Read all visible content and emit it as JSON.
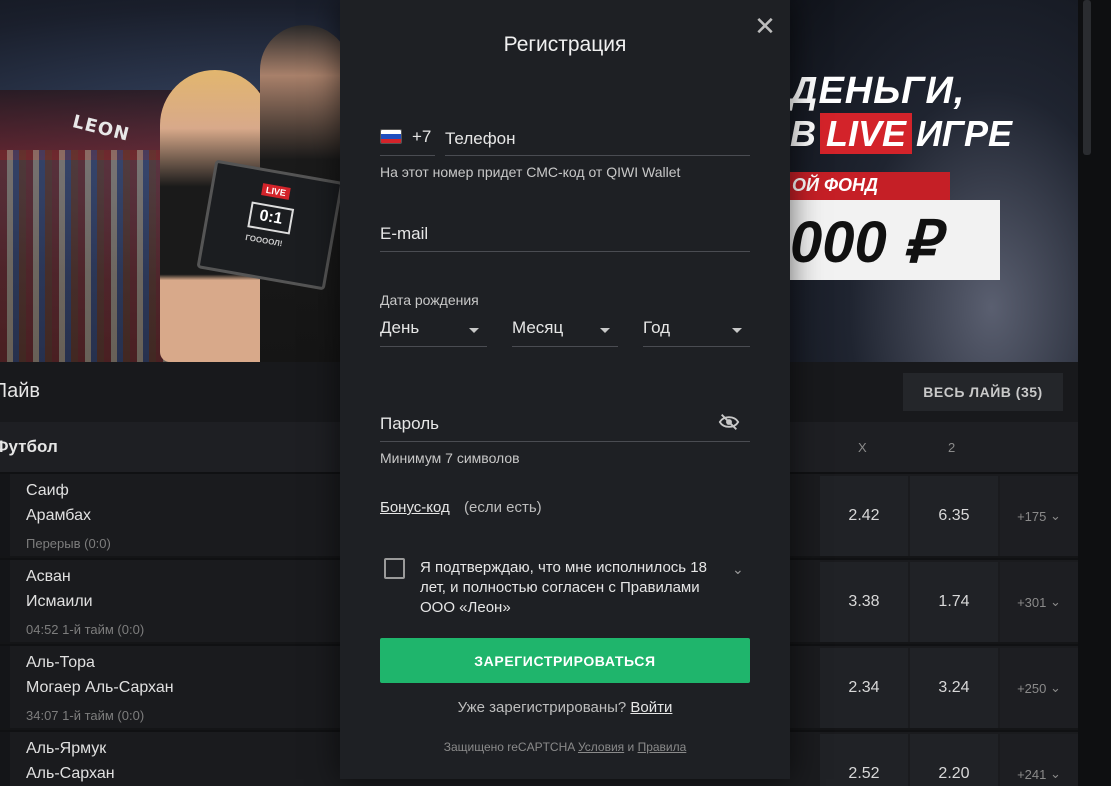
{
  "banner": {
    "sign": "LEON",
    "laptop_live": "LIVE",
    "laptop_score": "0:1",
    "laptop_goal": "ГООООЛ!",
    "promo_line1": "ДЕНЬГИ,",
    "promo_line2_pre": "В",
    "promo_live": "LIVE",
    "promo_line2_post": "ИГРЕ",
    "fund": "ОЙ ФОНД",
    "sum": "000 ₽"
  },
  "live": {
    "title": "Лайв",
    "all_live_button": "ВЕСЬ ЛАЙВ (35)",
    "sport": "Футбол",
    "col_x": "X",
    "col_2": "2",
    "matches": [
      {
        "team1": "Саиф",
        "team2": "Арамбах",
        "status": "Перерыв (0:0)",
        "odd_x": "2.42",
        "odd_2": "6.35",
        "more": "+175"
      },
      {
        "team1": "Асван",
        "team2": "Исмаили",
        "status": "04:52 1-й тайм (0:0)",
        "odd_x": "3.38",
        "odd_2": "1.74",
        "more": "+301"
      },
      {
        "team1": "Аль-Тора",
        "team2": "Могаер Аль-Сархан",
        "status": "34:07 1-й тайм (0:0)",
        "odd_x": "2.34",
        "odd_2": "3.24",
        "more": "+250"
      },
      {
        "team1": "Аль-Ярмук",
        "team2": "Аль-Сархан",
        "status": "",
        "odd_x": "2.52",
        "odd_2": "2.20",
        "more": "+241"
      }
    ]
  },
  "modal": {
    "title": "Регистрация",
    "close_icon": "close-icon",
    "phone_code": "+7",
    "phone_placeholder": "Телефон",
    "phone_hint": "На этот номер придет СМС-код от QIWI Wallet",
    "email_placeholder": "E-mail",
    "dob_label": "Дата рождения",
    "day": "День",
    "month": "Месяц",
    "year": "Год",
    "password_placeholder": "Пароль",
    "password_hint": "Минимум 7 символов",
    "bonus_link": "Бонус-код",
    "bonus_note": "(если есть)",
    "agree_text": "Я подтверждаю, что мне исполнилось 18 лет, и полностью согласен с Правилами ООО «Леон»",
    "submit": "ЗАРЕГИСТРИРОВАТЬСЯ",
    "already": "Уже зарегистрированы?",
    "login_link": "Войти",
    "captcha_pre": "Защищено reCAPTCHA",
    "captcha_terms": "Условия",
    "captcha_and": "и",
    "captcha_rules": "Правила"
  },
  "colors": {
    "accent_green": "#1fb56c",
    "live_red": "#d3232a",
    "modal_bg": "#1e2024"
  }
}
